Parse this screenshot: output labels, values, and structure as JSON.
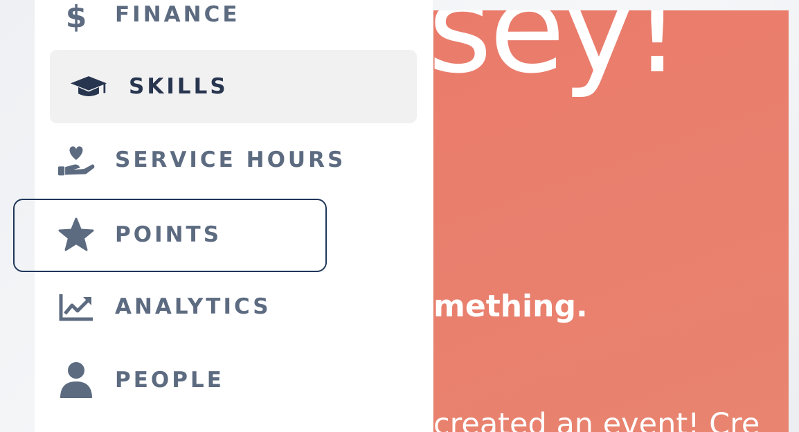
{
  "sidebar": {
    "items": [
      {
        "label": "FINANCE",
        "icon": "dollar-icon"
      },
      {
        "label": "SKILLS",
        "icon": "graduation-cap-icon",
        "active": true
      },
      {
        "label": "SERVICE HOURS",
        "icon": "hand-heart-icon"
      },
      {
        "label": "POINTS",
        "icon": "star-icon",
        "focused": true
      },
      {
        "label": "ANALYTICS",
        "icon": "chart-line-icon"
      },
      {
        "label": "PEOPLE",
        "icon": "person-icon"
      }
    ]
  },
  "hero": {
    "headline_fragment": "sey!",
    "subline_fragment": "mething.",
    "body_fragment": "created an event! Cre"
  },
  "colors": {
    "hero_background": "#ea7b6b",
    "nav_text": "#5d6b81",
    "nav_active_text": "#28354f",
    "active_background": "#f1f1f2",
    "focus_ring": "#1f3659"
  }
}
